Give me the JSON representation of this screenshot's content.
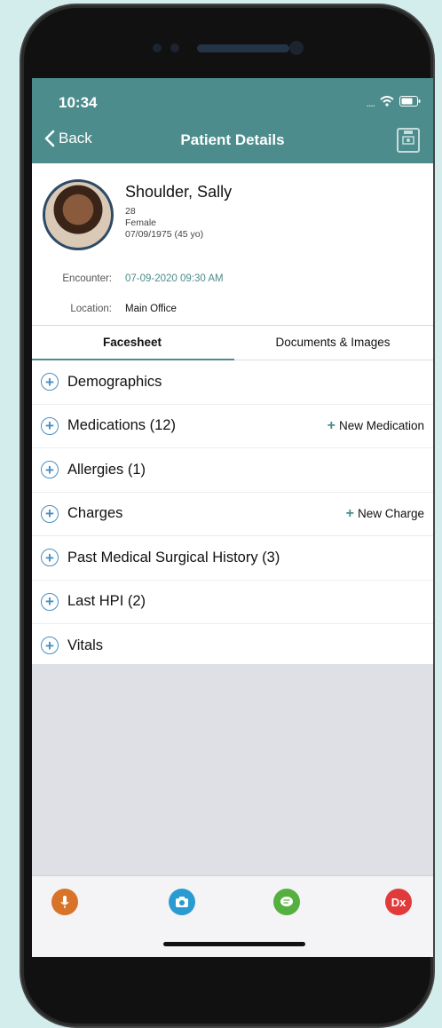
{
  "status": {
    "time": "10:34"
  },
  "nav": {
    "back_label": "Back",
    "title": "Patient Details"
  },
  "patient": {
    "name": "Shoulder, Sally",
    "age": "28",
    "gender": "Female",
    "dob": "07/09/1975 (45 yo)",
    "encounter_label": "Encounter:",
    "encounter_value": "07-09-2020 09:30 AM",
    "location_label": "Location:",
    "location_value": "Main Office"
  },
  "tabs": [
    {
      "label": "Facesheet",
      "active": true
    },
    {
      "label": "Documents & Images",
      "active": false
    }
  ],
  "sections": [
    {
      "label": "Demographics"
    },
    {
      "label": "Medications (12)",
      "action": "New Medication"
    },
    {
      "label": "Allergies (1)"
    },
    {
      "label": "Charges",
      "action": "New Charge"
    },
    {
      "label": "Past Medical Surgical History (3)"
    },
    {
      "label": "Last HPI (2)"
    },
    {
      "label": "Vitals"
    }
  ],
  "toolbar": [
    {
      "name": "microphone-icon",
      "color": "#d9732a"
    },
    {
      "name": "camera-icon",
      "color": "#2a9bd0"
    },
    {
      "name": "chat-icon",
      "color": "#55b040"
    },
    {
      "name": "dx-icon",
      "color": "#e03a3a",
      "text": "Dx"
    }
  ],
  "colors": {
    "header": "#4d8c8c",
    "link": "#4d8c8c",
    "plus": "#4a8fc2"
  }
}
